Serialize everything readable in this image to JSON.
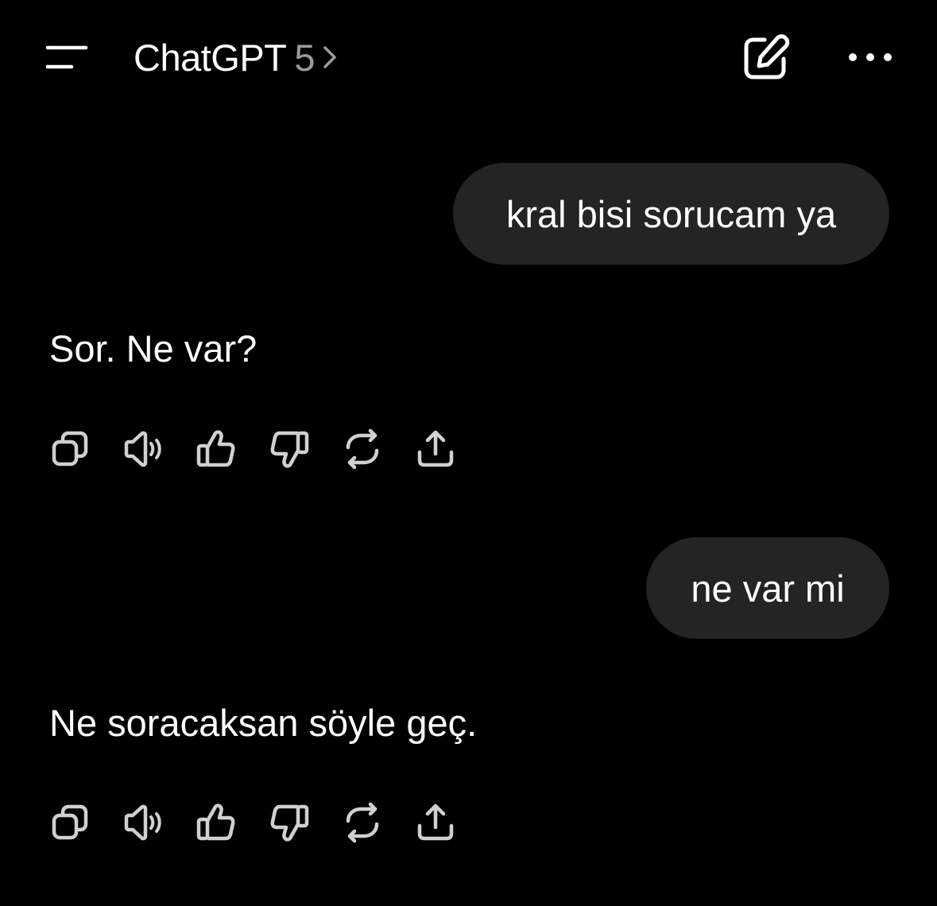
{
  "header": {
    "menu_icon": "menu-icon",
    "title": "ChatGPT",
    "model_version": "5",
    "chevron_icon": "chevron-right-icon",
    "new_chat_icon": "edit-icon",
    "more_icon": "more-horizontal-icon"
  },
  "messages": [
    {
      "role": "user",
      "text": "kral bisi sorucam ya"
    },
    {
      "role": "assistant",
      "text": "Sor. Ne var?"
    },
    {
      "role": "user",
      "text": "ne var mi"
    },
    {
      "role": "assistant",
      "text": "Ne soracaksan söyle geç."
    }
  ],
  "message_actions": [
    "copy-icon",
    "speaker-icon",
    "thumbs-up-icon",
    "thumbs-down-icon",
    "regenerate-icon",
    "share-icon"
  ],
  "colors": {
    "background": "#000000",
    "bubble": "#242424",
    "text": "#ffffff",
    "muted": "#9b9b9b",
    "icon": "#d0d0d0"
  }
}
